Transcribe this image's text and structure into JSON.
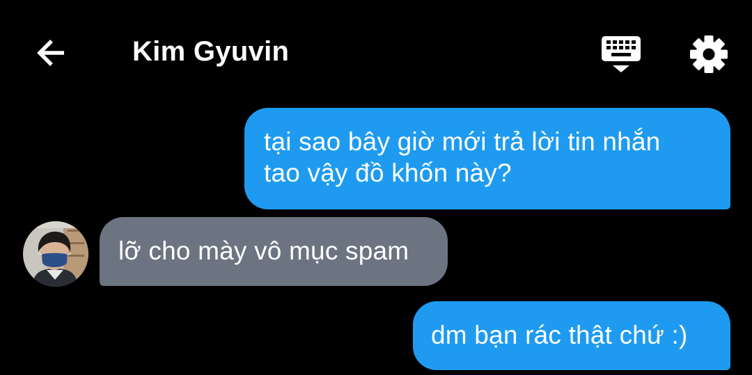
{
  "header": {
    "title": "Kim Gyuvin",
    "back_icon": "arrow-left-icon",
    "keyboard_icon": "keyboard-hide-icon",
    "settings_icon": "gear-icon"
  },
  "colors": {
    "background": "#000000",
    "sent_bubble": "#1e9bf0",
    "received_bubble": "#6b7480",
    "text": "#ffffff"
  },
  "messages": [
    {
      "direction": "sent",
      "lines": [
        "tại sao bây giờ mới trả lời tin nhắn",
        "tao vậy đồ khốn này?"
      ]
    },
    {
      "direction": "received",
      "lines": [
        "lỡ cho mày vô mục spam"
      ]
    },
    {
      "direction": "sent",
      "lines": [
        "dm bạn rác thật chứ :)"
      ]
    }
  ]
}
